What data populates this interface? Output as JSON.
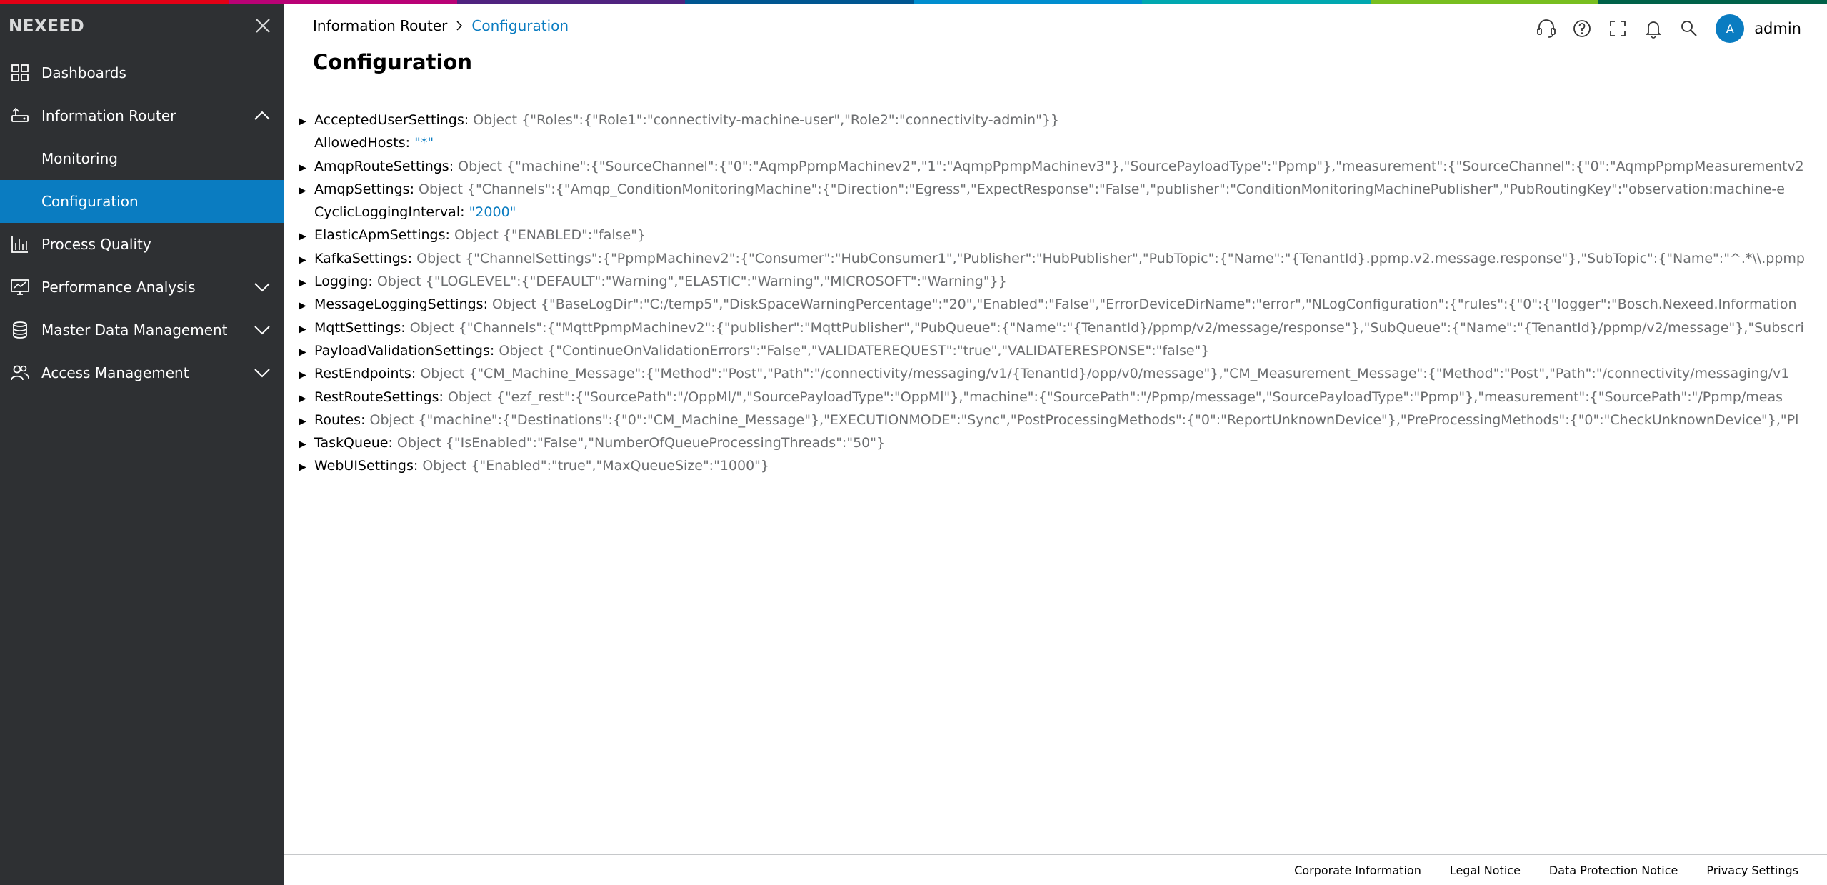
{
  "app": {
    "brand": "NEXEED"
  },
  "top_stripe_colors": [
    "#e20015",
    "#b90276",
    "#50237f",
    "#005691",
    "#008ecf",
    "#00a8b0",
    "#78be20",
    "#006249"
  ],
  "sidebar": {
    "items": [
      {
        "label": "Dashboards",
        "icon": "grid-icon"
      },
      {
        "label": "Information Router",
        "icon": "router-icon",
        "expanded": true
      },
      {
        "label": "Monitoring",
        "sub": true
      },
      {
        "label": "Configuration",
        "sub": true,
        "active": true
      },
      {
        "label": "Process Quality",
        "icon": "chart-quality-icon"
      },
      {
        "label": "Performance Analysis",
        "icon": "monitor-chart-icon",
        "collapsible": true
      },
      {
        "label": "Master Data Management",
        "icon": "database-icon",
        "collapsible": true
      },
      {
        "label": "Access Management",
        "icon": "users-icon",
        "collapsible": true
      }
    ]
  },
  "header": {
    "breadcrumb": [
      "Information Router",
      "Configuration"
    ],
    "title": "Configuration",
    "user": "admin",
    "avatar_letter": "A"
  },
  "config_rows": [
    {
      "key": "AcceptedUserSettings",
      "kind": "object",
      "value": "Object {\"Roles\":{\"Role1\":\"connectivity-machine-user\",\"Role2\":\"connectivity-admin\"}}"
    },
    {
      "key": "AllowedHosts",
      "kind": "string",
      "value": "\"*\""
    },
    {
      "key": "AmqpRouteSettings",
      "kind": "object",
      "value": "Object {\"machine\":{\"SourceChannel\":{\"0\":\"AqmpPpmpMachinev2\",\"1\":\"AqmpPpmpMachinev3\"},\"SourcePayloadType\":\"Ppmp\"},\"measurement\":{\"SourceChannel\":{\"0\":\"AqmpPpmpMeasurementv2"
    },
    {
      "key": "AmqpSettings",
      "kind": "object",
      "value": "Object {\"Channels\":{\"Amqp_ConditionMonitoringMachine\":{\"Direction\":\"Egress\",\"ExpectResponse\":\"False\",\"publisher\":\"ConditionMonitoringMachinePublisher\",\"PubRoutingKey\":\"observation:machine-e"
    },
    {
      "key": "CyclicLoggingInterval",
      "kind": "string",
      "value": "\"2000\""
    },
    {
      "key": "ElasticApmSettings",
      "kind": "object",
      "value": "Object {\"ENABLED\":\"false\"}"
    },
    {
      "key": "KafkaSettings",
      "kind": "object",
      "value": "Object {\"ChannelSettings\":{\"PpmpMachinev2\":{\"Consumer\":\"HubConsumer1\",\"Publisher\":\"HubPublisher\",\"PubTopic\":{\"Name\":\"{TenantId}.ppmp.v2.message.response\"},\"SubTopic\":{\"Name\":\"^.*\\\\.ppmp"
    },
    {
      "key": "Logging",
      "kind": "object",
      "value": "Object {\"LOGLEVEL\":{\"DEFAULT\":\"Warning\",\"ELASTIC\":\"Warning\",\"MICROSOFT\":\"Warning\"}}"
    },
    {
      "key": "MessageLoggingSettings",
      "kind": "object",
      "value": "Object {\"BaseLogDir\":\"C:/temp5\",\"DiskSpaceWarningPercentage\":\"20\",\"Enabled\":\"False\",\"ErrorDeviceDirName\":\"error\",\"NLogConfiguration\":{\"rules\":{\"0\":{\"logger\":\"Bosch.Nexeed.Information"
    },
    {
      "key": "MqttSettings",
      "kind": "object",
      "value": "Object {\"Channels\":{\"MqttPpmpMachinev2\":{\"publisher\":\"MqttPublisher\",\"PubQueue\":{\"Name\":\"{TenantId}/ppmp/v2/message/response\"},\"SubQueue\":{\"Name\":\"{TenantId}/ppmp/v2/message\"},\"Subscri"
    },
    {
      "key": "PayloadValidationSettings",
      "kind": "object",
      "value": "Object {\"ContinueOnValidationErrors\":\"False\",\"VALIDATEREQUEST\":\"true\",\"VALIDATERESPONSE\":\"false\"}"
    },
    {
      "key": "RestEndpoints",
      "kind": "object",
      "value": "Object {\"CM_Machine_Message\":{\"Method\":\"Post\",\"Path\":\"/connectivity/messaging/v1/{TenantId}/opp/v0/message\"},\"CM_Measurement_Message\":{\"Method\":\"Post\",\"Path\":\"/connectivity/messaging/v1"
    },
    {
      "key": "RestRouteSettings",
      "kind": "object",
      "value": "Object {\"ezf_rest\":{\"SourcePath\":\"/OppMl/\",\"SourcePayloadType\":\"OppMl\"},\"machine\":{\"SourcePath\":\"/Ppmp/message\",\"SourcePayloadType\":\"Ppmp\"},\"measurement\":{\"SourcePath\":\"/Ppmp/meas"
    },
    {
      "key": "Routes",
      "kind": "object",
      "value": "Object {\"machine\":{\"Destinations\":{\"0\":\"CM_Machine_Message\"},\"EXECUTIONMODE\":\"Sync\",\"PostProcessingMethods\":{\"0\":\"ReportUnknownDevice\"},\"PreProcessingMethods\":{\"0\":\"CheckUnknownDevice\"},\"Pl"
    },
    {
      "key": "TaskQueue",
      "kind": "object",
      "value": "Object {\"IsEnabled\":\"False\",\"NumberOfQueueProcessingThreads\":\"50\"}"
    },
    {
      "key": "WebUISettings",
      "kind": "object",
      "value": "Object {\"Enabled\":\"true\",\"MaxQueueSize\":\"1000\"}"
    }
  ],
  "footer": {
    "links": [
      "Corporate Information",
      "Legal Notice",
      "Data Protection Notice",
      "Privacy Settings"
    ]
  }
}
